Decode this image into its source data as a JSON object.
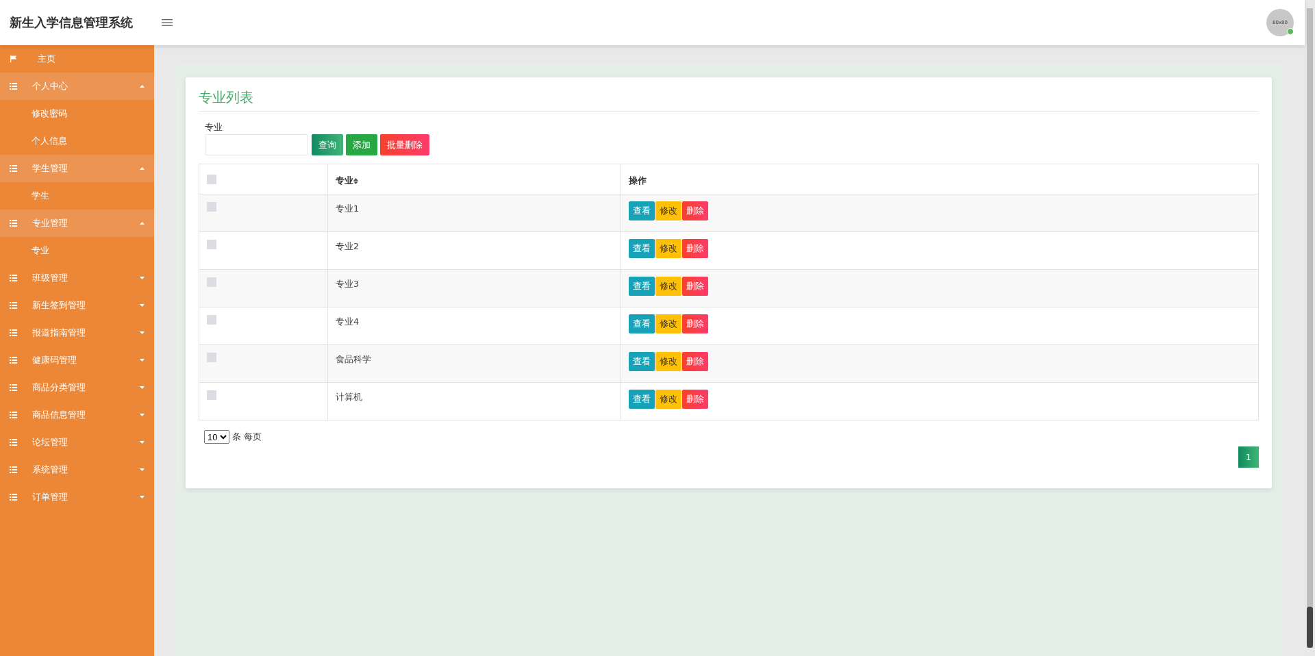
{
  "header": {
    "title": "新生入学信息管理系统",
    "avatar_text": "80x80",
    "online": true
  },
  "sidebar": {
    "items": [
      {
        "kind": "home",
        "label": "主页"
      },
      {
        "kind": "group",
        "label": "个人中心",
        "expanded": true,
        "children": [
          {
            "label": "修改密码"
          },
          {
            "label": "个人信息"
          }
        ]
      },
      {
        "kind": "group",
        "label": "学生管理",
        "expanded": true,
        "children": [
          {
            "label": "学生"
          }
        ]
      },
      {
        "kind": "group",
        "label": "专业管理",
        "expanded": true,
        "children": [
          {
            "label": "专业"
          }
        ]
      },
      {
        "kind": "group",
        "label": "班级管理",
        "expanded": false
      },
      {
        "kind": "group",
        "label": "新生签到管理",
        "expanded": false
      },
      {
        "kind": "group",
        "label": "报道指南管理",
        "expanded": false
      },
      {
        "kind": "group",
        "label": "健康码管理",
        "expanded": false
      },
      {
        "kind": "group",
        "label": "商品分类管理",
        "expanded": false
      },
      {
        "kind": "group",
        "label": "商品信息管理",
        "expanded": false
      },
      {
        "kind": "group",
        "label": "论坛管理",
        "expanded": false
      },
      {
        "kind": "group",
        "label": "系统管理",
        "expanded": false
      },
      {
        "kind": "group",
        "label": "订单管理",
        "expanded": false
      }
    ]
  },
  "card": {
    "title": "专业列表",
    "search": {
      "label": "专业"
    },
    "toolbar": [
      {
        "label": "查询",
        "kind": "search"
      },
      {
        "label": "添加",
        "kind": "add"
      },
      {
        "label": "批量删除",
        "kind": "delete"
      }
    ],
    "table": {
      "header_checked": false,
      "columns": [
        {
          "label": "专业",
          "sortable": true
        },
        {
          "label": "操作",
          "sortable": false
        }
      ],
      "rows": [
        {
          "checked": false,
          "name": "专业1",
          "actions": [
            {
              "label": "查看",
              "kind": "view"
            },
            {
              "label": "修改",
              "kind": "edit"
            },
            {
              "label": "删除",
              "kind": "delete"
            }
          ]
        },
        {
          "checked": false,
          "name": "专业2",
          "actions": [
            {
              "label": "查看",
              "kind": "view"
            },
            {
              "label": "修改",
              "kind": "edit"
            },
            {
              "label": "删除",
              "kind": "delete"
            }
          ]
        },
        {
          "checked": false,
          "name": "专业3",
          "actions": [
            {
              "label": "查看",
              "kind": "view"
            },
            {
              "label": "修改",
              "kind": "edit"
            },
            {
              "label": "删除",
              "kind": "delete"
            }
          ]
        },
        {
          "checked": false,
          "name": "专业4",
          "actions": [
            {
              "label": "查看",
              "kind": "view"
            },
            {
              "label": "修改",
              "kind": "edit"
            },
            {
              "label": "删除",
              "kind": "delete"
            }
          ]
        },
        {
          "checked": false,
          "name": "食品科学",
          "actions": [
            {
              "label": "查看",
              "kind": "view"
            },
            {
              "label": "修改",
              "kind": "edit"
            },
            {
              "label": "删除",
              "kind": "delete"
            }
          ]
        },
        {
          "checked": false,
          "name": "计算机",
          "actions": [
            {
              "label": "查看",
              "kind": "view"
            },
            {
              "label": "修改",
              "kind": "edit"
            },
            {
              "label": "删除",
              "kind": "delete"
            }
          ]
        }
      ]
    },
    "pagination": {
      "page_size": "10",
      "page_size_label": "条 每页",
      "pages": [
        {
          "label": "1",
          "selected": true
        }
      ]
    }
  }
}
